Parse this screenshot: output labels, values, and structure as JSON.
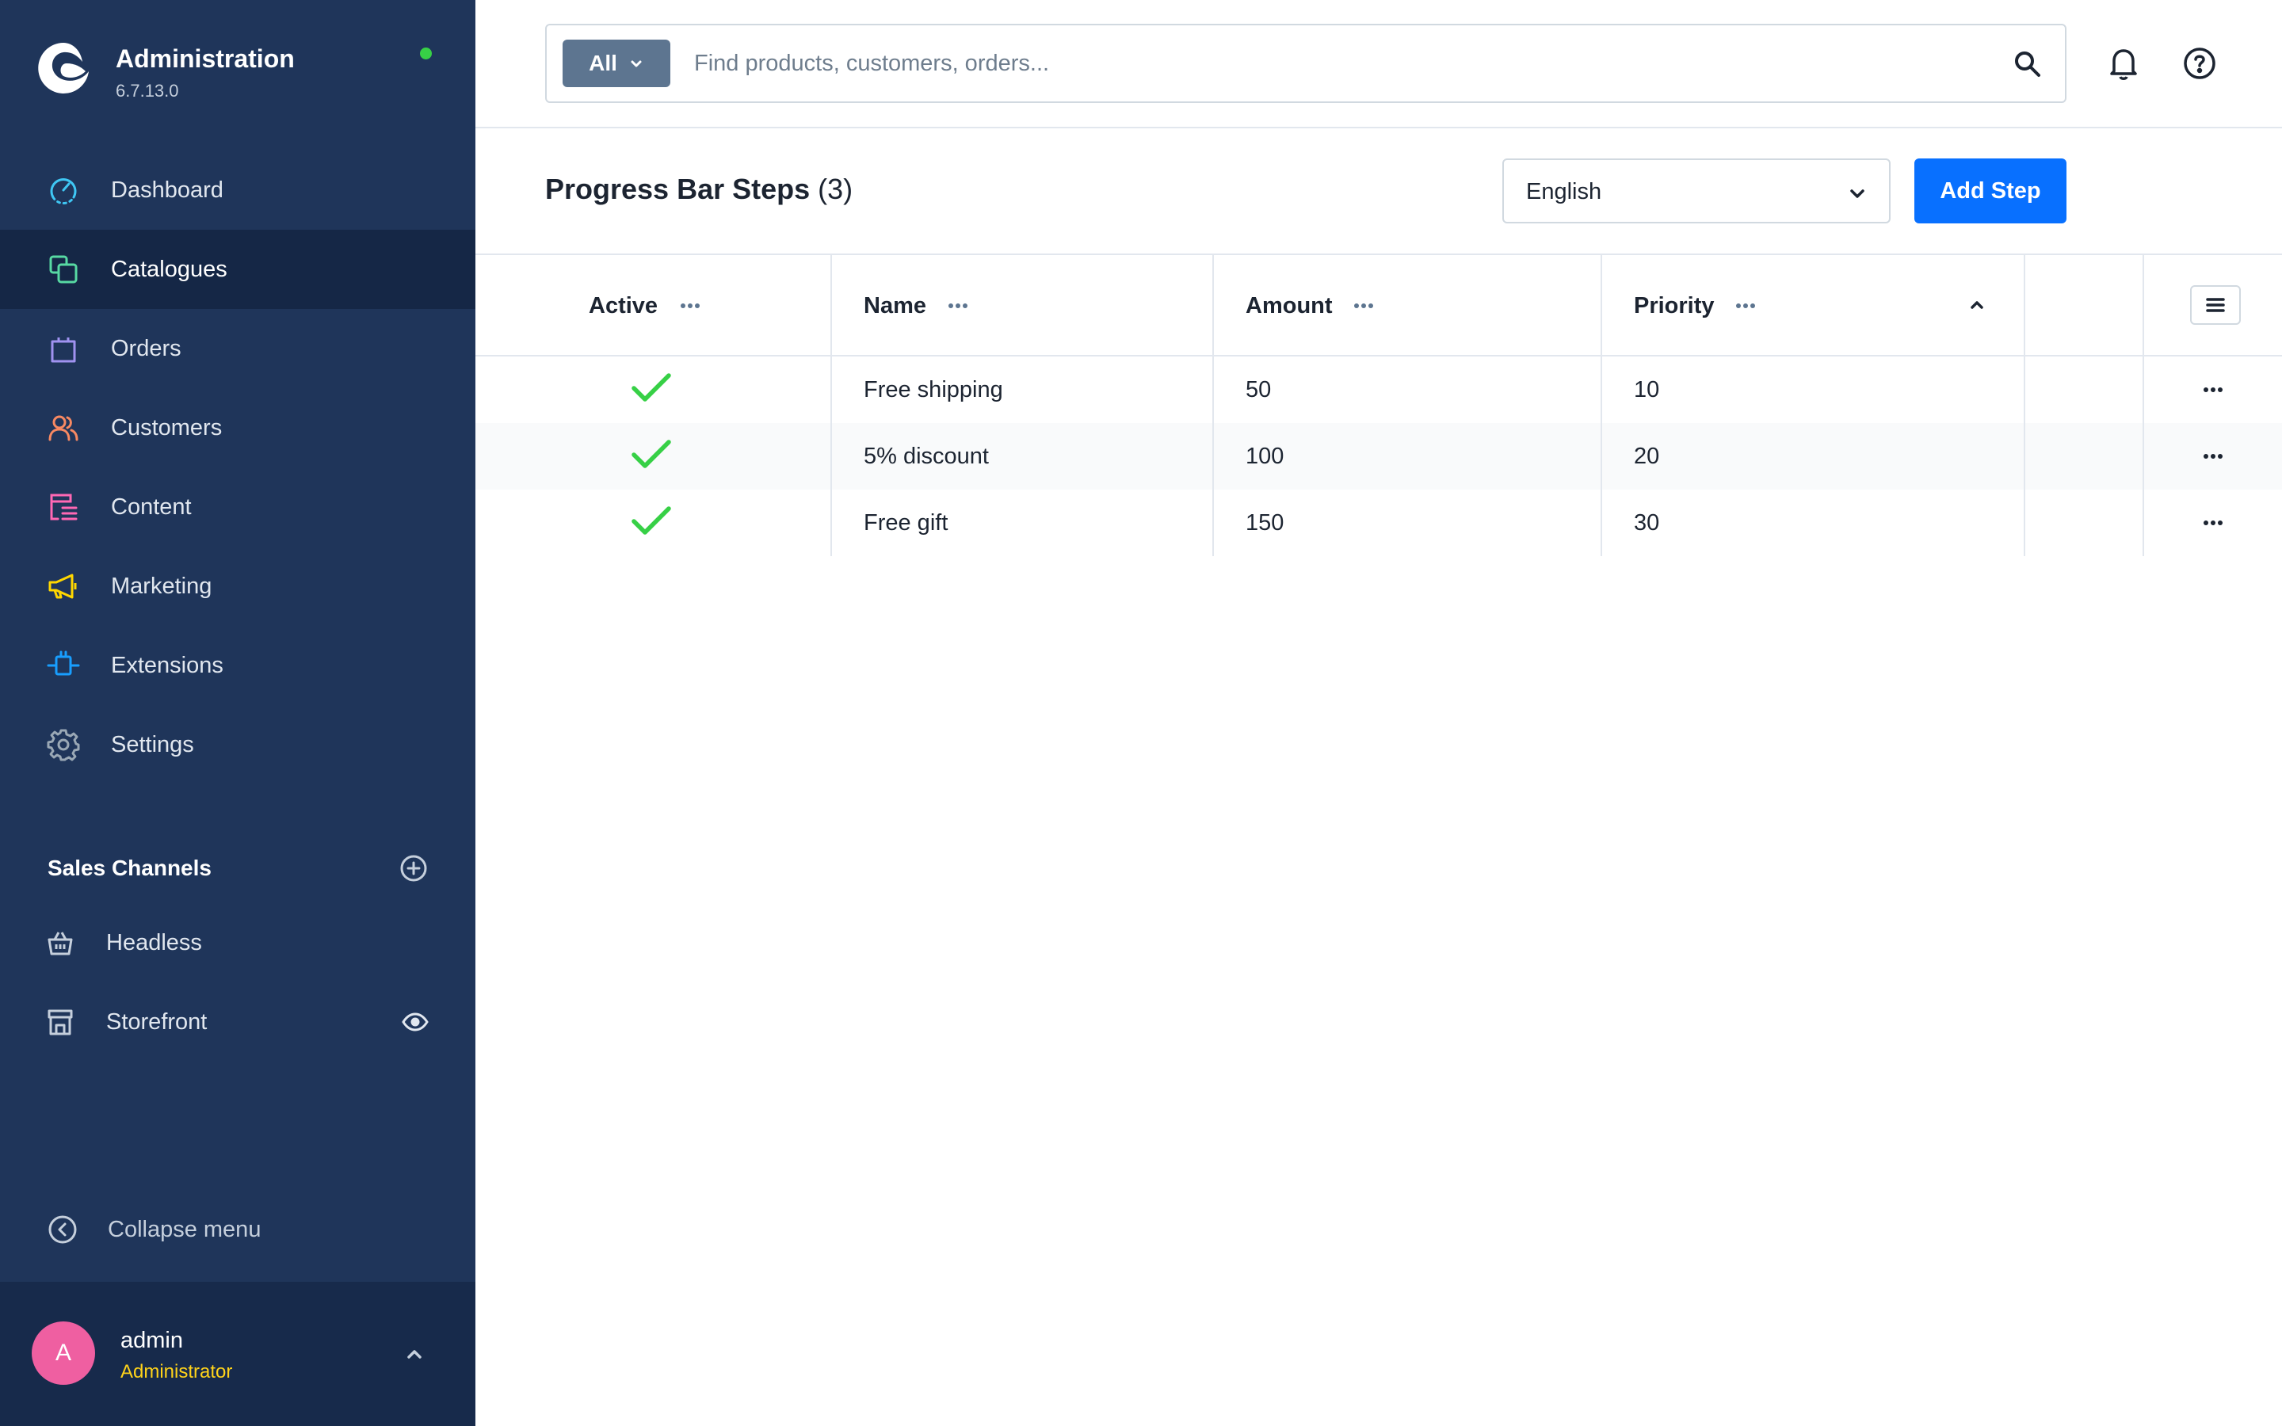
{
  "app": {
    "title": "Administration",
    "version": "6.7.13.0",
    "status_color": "#37d046"
  },
  "sidebar": {
    "items": [
      {
        "label": "Dashboard",
        "icon": "dashboard-gauge-icon",
        "color": "#3fc7f4"
      },
      {
        "label": "Catalogues",
        "icon": "catalogues-icon",
        "color": "#57d9a3",
        "active": true
      },
      {
        "label": "Orders",
        "icon": "orders-bag-icon",
        "color": "#a092f0"
      },
      {
        "label": "Customers",
        "icon": "customers-icon",
        "color": "#f88962"
      },
      {
        "label": "Content",
        "icon": "content-icon",
        "color": "#ff68b4"
      },
      {
        "label": "Marketing",
        "icon": "marketing-megaphone-icon",
        "color": "#ffd700"
      },
      {
        "label": "Extensions",
        "icon": "extensions-plug-icon",
        "color": "#189eff"
      },
      {
        "label": "Settings",
        "icon": "settings-gear-icon",
        "color": "#9aa8b5"
      }
    ],
    "sales_channels": {
      "title": "Sales Channels",
      "items": [
        {
          "label": "Headless",
          "icon": "basket-icon"
        },
        {
          "label": "Storefront",
          "icon": "storefront-icon"
        }
      ]
    },
    "collapse_label": "Collapse menu"
  },
  "user": {
    "initial": "A",
    "name": "admin",
    "role": "Administrator",
    "avatar_color": "#ef5fa1",
    "role_color": "#ffd31a"
  },
  "search": {
    "type_label": "All",
    "placeholder": "Find products, customers, orders..."
  },
  "page": {
    "title": "Progress Bar Steps",
    "count": "(3)",
    "language": "English",
    "add_label": "Add Step",
    "accent": "#0870ff"
  },
  "grid": {
    "columns": {
      "active": "Active",
      "name": "Name",
      "amount": "Amount",
      "priority": "Priority"
    },
    "sort": {
      "column": "priority",
      "direction": "ascending"
    },
    "rows": [
      {
        "active": true,
        "name": "Free shipping",
        "amount": "50",
        "priority": "10"
      },
      {
        "active": true,
        "name": "5% discount",
        "amount": "100",
        "priority": "20"
      },
      {
        "active": true,
        "name": "Free gift",
        "amount": "150",
        "priority": "30"
      }
    ]
  }
}
